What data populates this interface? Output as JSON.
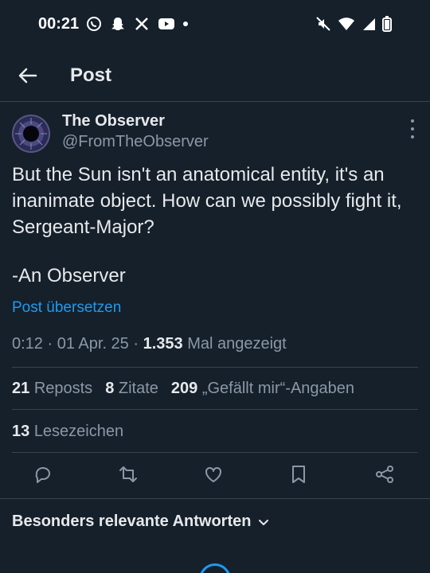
{
  "status_bar": {
    "time": "00:21"
  },
  "header": {
    "title": "Post"
  },
  "post": {
    "display_name": "The Observer",
    "handle": "@FromTheObserver",
    "text": "But the Sun isn't an anatomical entity, it's an inanimate object. How can we possibly fight it, Sergeant-Major?",
    "signature": "-An Observer",
    "translate_label": "Post übersetzen",
    "time": "0:12",
    "date": "01 Apr. 25",
    "views": "1.353",
    "views_label": "Mal angezeigt"
  },
  "stats": {
    "reposts_count": "21",
    "reposts_label": "Reposts",
    "quotes_count": "8",
    "quotes_label": "Zitate",
    "likes_count": "209",
    "likes_label": "„Gefällt mir“-Angaben",
    "bookmarks_count": "13",
    "bookmarks_label": "Lesezeichen"
  },
  "replies": {
    "sort_label": "Besonders relevante Antworten"
  },
  "colors": {
    "background": "#15202b",
    "accent": "#1d9bf0",
    "secondary_text": "#8b98a5",
    "divider": "#38444d"
  }
}
